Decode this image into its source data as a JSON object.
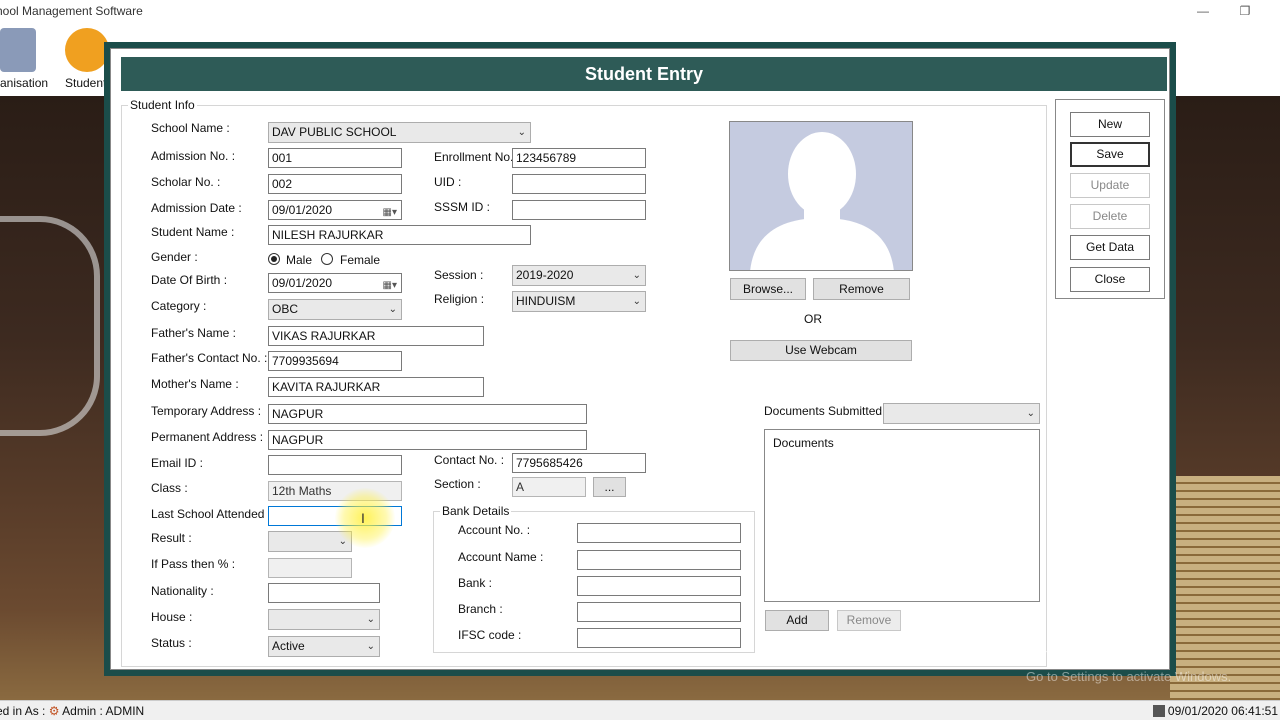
{
  "window": {
    "title": "hool Management Software"
  },
  "toolbar": [
    {
      "label": "anisation",
      "icon": "organisation-icon",
      "color": "#7d8fb0"
    },
    {
      "label": "Student",
      "icon": "student-icon",
      "color": "#f0a020"
    }
  ],
  "dialog": {
    "title": "Student Entry",
    "group_title": "Student Info",
    "fields": {
      "school_name": {
        "label": "School Name :",
        "value": "DAV PUBLIC  SCHOOL"
      },
      "admission_no": {
        "label": "Admission No. :",
        "value": "001"
      },
      "enrollment_no": {
        "label": "Enrollment No.",
        "value": "123456789"
      },
      "scholar_no": {
        "label": "Scholar No. :",
        "value": "002"
      },
      "uid": {
        "label": "UID :",
        "value": ""
      },
      "admission_date": {
        "label": "Admission Date :",
        "value": "09/01/2020"
      },
      "sssm_id": {
        "label": "SSSM ID :",
        "value": ""
      },
      "student_name": {
        "label": "Student Name :",
        "value": "NILESH RAJURKAR"
      },
      "gender": {
        "label": "Gender :",
        "options": [
          "Male",
          "Female"
        ],
        "selected": "Male"
      },
      "dob": {
        "label": "Date Of Birth :",
        "value": "09/01/2020"
      },
      "session": {
        "label": "Session :",
        "value": "2019-2020"
      },
      "category": {
        "label": "Category :",
        "value": "OBC"
      },
      "religion": {
        "label": "Religion :",
        "value": "HINDUISM"
      },
      "father_name": {
        "label": "Father's Name :",
        "value": "VIKAS RAJURKAR"
      },
      "father_contact": {
        "label": "Father's Contact No. :",
        "value": "7709935694"
      },
      "mother_name": {
        "label": "Mother's Name :",
        "value": "KAVITA RAJURKAR"
      },
      "temp_address": {
        "label": "Temporary Address :",
        "value": "NAGPUR"
      },
      "perm_address": {
        "label": "Permanent Address :",
        "value": "NAGPUR"
      },
      "email": {
        "label": "Email ID :",
        "value": ""
      },
      "contact_no": {
        "label": "Contact No. :",
        "value": "7795685426"
      },
      "class": {
        "label": "Class :",
        "value": "12th Maths"
      },
      "section": {
        "label": "Section :",
        "value": "A",
        "button": "..."
      },
      "last_school": {
        "label": "Last School Attended :",
        "value": ""
      },
      "result": {
        "label": "Result :",
        "value": ""
      },
      "pass_percent": {
        "label": "If Pass then % :",
        "value": ""
      },
      "nationality": {
        "label": "Nationality :",
        "value": ""
      },
      "house": {
        "label": "House :",
        "value": ""
      },
      "status": {
        "label": "Status :",
        "value": "Active"
      }
    },
    "bank": {
      "title": "Bank Details",
      "account_no": {
        "label": "Account No. :",
        "value": ""
      },
      "account_name": {
        "label": "Account Name :",
        "value": ""
      },
      "bank": {
        "label": "Bank :",
        "value": ""
      },
      "branch": {
        "label": "Branch :",
        "value": ""
      },
      "ifsc": {
        "label": "IFSC code :",
        "value": ""
      }
    },
    "photo": {
      "browse": "Browse...",
      "remove": "Remove",
      "or": "OR",
      "webcam": "Use Webcam"
    },
    "documents": {
      "label": "Documents Submitted :",
      "selected": "",
      "list_header": "Documents",
      "add": "Add",
      "remove": "Remove"
    },
    "actions": {
      "new": "New",
      "save": "Save",
      "update": "Update",
      "delete": "Delete",
      "get_data": "Get Data",
      "close": "Close"
    }
  },
  "statusbar": {
    "logged_in": "ed in As :",
    "user": "Admin",
    "separator": ":",
    "role": "ADMIN",
    "datetime": "09/01/2020 06:41:51"
  },
  "watermark": {
    "line1": "Activate Windows",
    "line2": "Go to Settings to activate Windows."
  }
}
